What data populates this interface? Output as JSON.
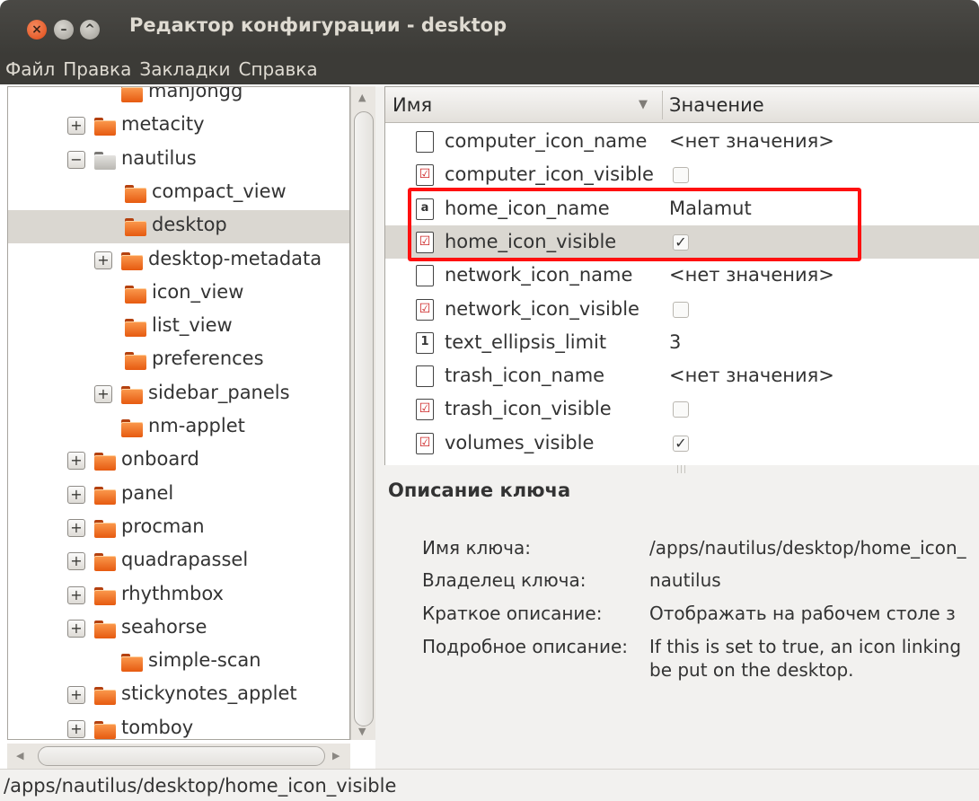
{
  "window": {
    "title": "Редактор конфигурации - desktop",
    "buttons": {
      "close": "×",
      "minimize": "–",
      "maximize": "^"
    }
  },
  "menu": [
    "Файл",
    "Правка",
    "Закладки",
    "Справка"
  ],
  "tree": {
    "items": [
      {
        "label": "mahjongg",
        "expander": "",
        "color": "orange"
      },
      {
        "label": "metacity",
        "expander": "+",
        "color": "orange"
      },
      {
        "label": "nautilus",
        "expander": "−",
        "color": "grey"
      },
      {
        "label": "compact_view",
        "expander": "",
        "color": "orange"
      },
      {
        "label": "desktop",
        "expander": "",
        "color": "orange",
        "selected": true
      },
      {
        "label": "desktop-metadata",
        "expander": "+",
        "color": "orange"
      },
      {
        "label": "icon_view",
        "expander": "",
        "color": "orange"
      },
      {
        "label": "list_view",
        "expander": "",
        "color": "orange"
      },
      {
        "label": "preferences",
        "expander": "",
        "color": "orange"
      },
      {
        "label": "sidebar_panels",
        "expander": "+",
        "color": "orange"
      },
      {
        "label": "nm-applet",
        "expander": "",
        "color": "orange"
      },
      {
        "label": "onboard",
        "expander": "+",
        "color": "orange"
      },
      {
        "label": "panel",
        "expander": "+",
        "color": "orange"
      },
      {
        "label": "procman",
        "expander": "+",
        "color": "orange"
      },
      {
        "label": "quadrapassel",
        "expander": "+",
        "color": "orange"
      },
      {
        "label": "rhythmbox",
        "expander": "+",
        "color": "orange"
      },
      {
        "label": "seahorse",
        "expander": "+",
        "color": "orange"
      },
      {
        "label": "simple-scan",
        "expander": "",
        "color": "orange"
      },
      {
        "label": "stickynotes_applet",
        "expander": "+",
        "color": "orange"
      },
      {
        "label": "tomboy",
        "expander": "+",
        "color": "orange"
      }
    ]
  },
  "keys": {
    "col_name": "Имя",
    "col_value": "Значение",
    "sort_arrow": "▼",
    "rows": [
      {
        "name": "computer_icon_name",
        "type": "string",
        "icon": "",
        "value": "<нет значения>"
      },
      {
        "name": "computer_icon_visible",
        "type": "bool",
        "icon": "☑",
        "checked": false
      },
      {
        "name": "home_icon_name",
        "type": "string",
        "icon": "a",
        "value": "Malamut"
      },
      {
        "name": "home_icon_visible",
        "type": "bool",
        "icon": "☑",
        "checked": true,
        "selected": true
      },
      {
        "name": "network_icon_name",
        "type": "string",
        "icon": "",
        "value": "<нет значения>"
      },
      {
        "name": "network_icon_visible",
        "type": "bool",
        "icon": "☑",
        "checked": false
      },
      {
        "name": "text_ellipsis_limit",
        "type": "int",
        "icon": "1",
        "value": "3"
      },
      {
        "name": "trash_icon_name",
        "type": "string",
        "icon": "",
        "value": "<нет значения>"
      },
      {
        "name": "trash_icon_visible",
        "type": "bool",
        "icon": "☑",
        "checked": false
      },
      {
        "name": "volumes_visible",
        "type": "bool",
        "icon": "☑",
        "checked": true
      }
    ]
  },
  "description": {
    "title": "Описание ключа",
    "key_name_label": "Имя ключа:",
    "key_name_value": "/apps/nautilus/desktop/home_icon_",
    "owner_label": "Владелец ключа:",
    "owner_value": "nautilus",
    "short_label": "Краткое описание:",
    "short_value": "Отображать на рабочем столе з",
    "long_label": "Подробное описание:",
    "long_value_line1": "If this is set to true, an icon linking",
    "long_value_line2": "be put on the desktop."
  },
  "status": "/apps/nautilus/desktop/home_icon_visible"
}
